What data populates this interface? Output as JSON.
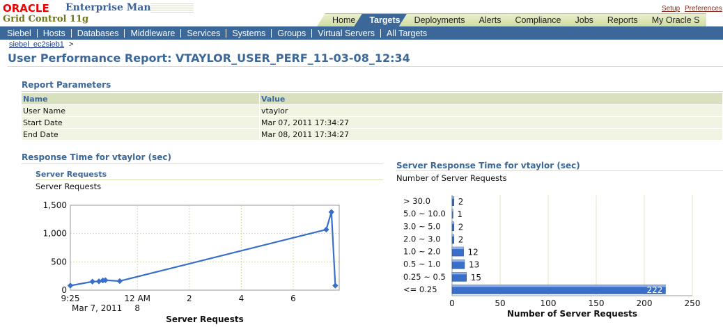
{
  "header": {
    "brand": "ORACLE",
    "product": "Enterprise Manager",
    "edition": "Grid Control 11g",
    "links": [
      "Setup",
      "Preferences"
    ]
  },
  "tabs": [
    "Home",
    "Targets",
    "Deployments",
    "Alerts",
    "Compliance",
    "Jobs",
    "Reports",
    "My Oracle S"
  ],
  "subnav": [
    "Siebel",
    "Hosts",
    "Databases",
    "Middleware",
    "Services",
    "Systems",
    "Groups",
    "Virtual Servers",
    "All Targets"
  ],
  "breadcrumb": {
    "link": "siebel_ec2sieb1",
    "sep": ">"
  },
  "page_title": "User Performance Report: VTAYLOR_USER_PERF_11-03-08_12:34",
  "report_parameters": {
    "heading": "Report Parameters",
    "columns": [
      "Name",
      "Value"
    ],
    "rows": [
      [
        "User Name",
        "vtaylor"
      ],
      [
        "Start Date",
        "Mar 07, 2011 17:34:27"
      ],
      [
        "End Date",
        "Mar 08, 2011 17:34:27"
      ]
    ]
  },
  "left_section": {
    "heading": "Response Time for vtaylor (sec)",
    "subheading": "Server Requests",
    "chart_caption": "Server Requests"
  },
  "right_section": {
    "heading": "Server Response Time for vtaylor (sec)",
    "chart_caption": "Number of Server Requests"
  },
  "colors": {
    "brand_blue": "#3b6799",
    "oracle_red": "#e00000",
    "series_blue": "#3a6fc9"
  },
  "chart_data": [
    {
      "type": "line",
      "title": "Server Requests",
      "xlabel": "Server Requests",
      "ylabel": "",
      "x_ticks": [
        "9:25",
        "12 AM",
        "2",
        "4",
        "6"
      ],
      "x_tick_sublabels": [
        "Mar 7, 2011",
        "8"
      ],
      "y_ticks": [
        "0",
        "500",
        "1,000",
        "1,500"
      ],
      "ylim": [
        0,
        1500
      ],
      "grid": true,
      "series": [
        {
          "values_hours_after_925": [
            [
              0,
              80
            ],
            [
              0.85,
              150
            ],
            [
              1.1,
              155
            ],
            [
              1.25,
              170
            ],
            [
              1.35,
              175
            ],
            [
              1.9,
              160
            ],
            [
              9.85,
              1070
            ],
            [
              10.05,
              1380
            ],
            [
              10.2,
              80
            ]
          ]
        }
      ]
    },
    {
      "type": "bar",
      "orientation": "horizontal",
      "title": "Number of Server Requests",
      "xlabel": "Number of Server Requests",
      "categories": [
        "> 30.0",
        "5.0 ~ 10.0",
        "3.0 ~ 5.0",
        "2.0 ~ 3.0",
        "1.0 ~ 2.0",
        "0.5 ~ 1.0",
        "0.25 ~ 0.5",
        "<= 0.25"
      ],
      "values": [
        2,
        1,
        2,
        2,
        12,
        13,
        15,
        222
      ],
      "x_ticks": [
        "0",
        "50",
        "100",
        "150",
        "200",
        "250"
      ],
      "xlim": [
        0,
        250
      ],
      "grid": true
    }
  ]
}
